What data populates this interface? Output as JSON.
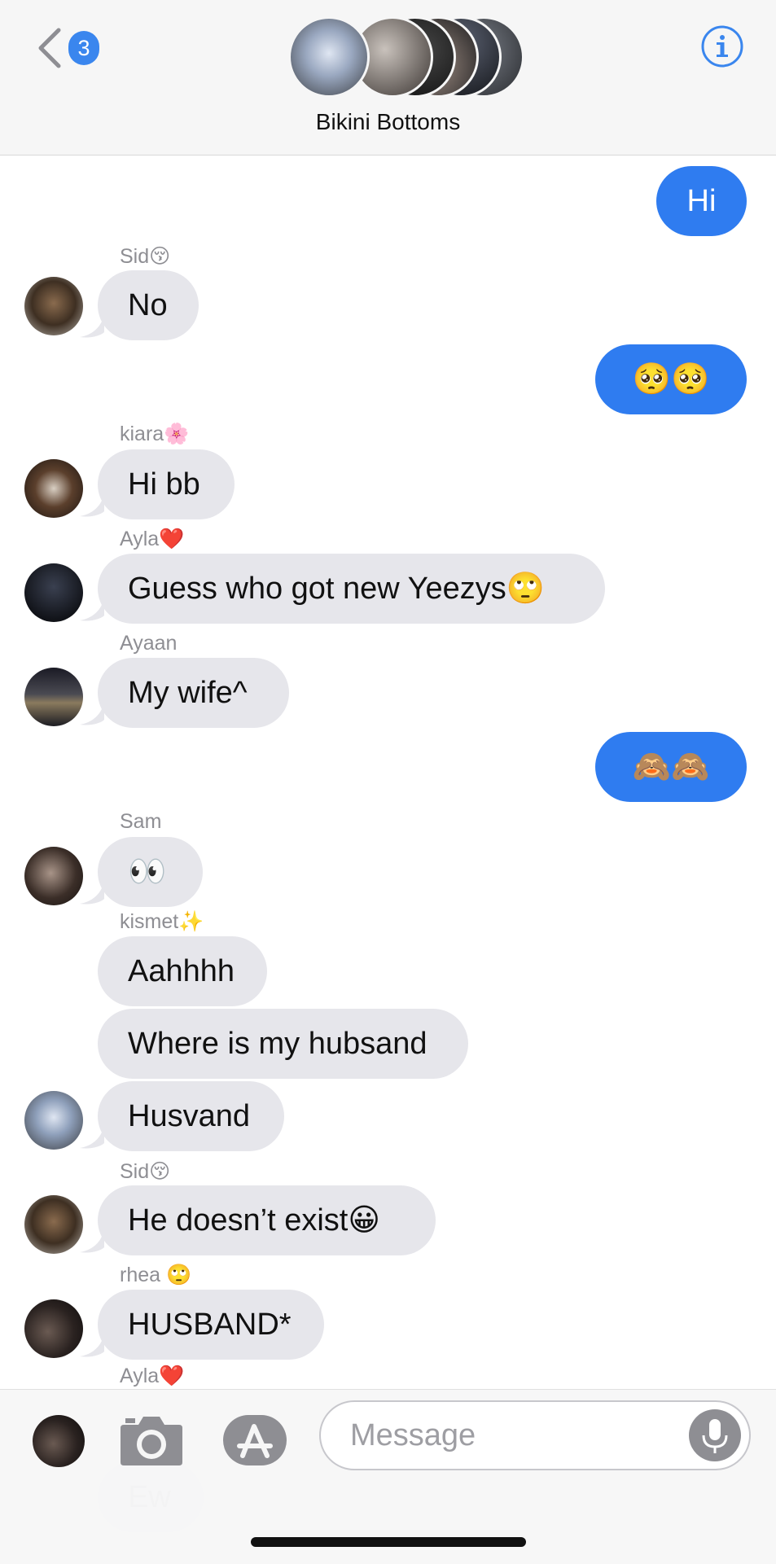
{
  "header": {
    "back_badge": "3",
    "group_name": "Bikini Bottoms"
  },
  "messages": [
    {
      "text": "Hi"
    },
    {
      "sender": "Sid😚",
      "text": "No"
    },
    {
      "text": "🥺🥺"
    },
    {
      "sender": "kiara🌸",
      "text": "Hi bb"
    },
    {
      "sender": "Ayla❤️",
      "text": "Guess who got new Yeezys🙄"
    },
    {
      "sender": "Ayaan",
      "text": "My wife^"
    },
    {
      "text": "🙈🙈"
    },
    {
      "sender": "Sam",
      "text": "👀"
    },
    {
      "sender": "kismet✨",
      "text": "Aahhhh"
    },
    {
      "text": "Where is my hubsand"
    },
    {
      "text": "Husvand"
    },
    {
      "sender": "Sid😚",
      "text": "He doesn’t exist😀"
    },
    {
      "sender": "rhea 🙄",
      "text": "HUSBAND*"
    },
    {
      "sender": "Ayla❤️",
      "text": "Ew"
    }
  ],
  "input": {
    "placeholder": "Message"
  },
  "colors": {
    "outgoing": "#2f7cf0",
    "incoming": "#e6e6eb",
    "accent": "#3a86ee"
  }
}
